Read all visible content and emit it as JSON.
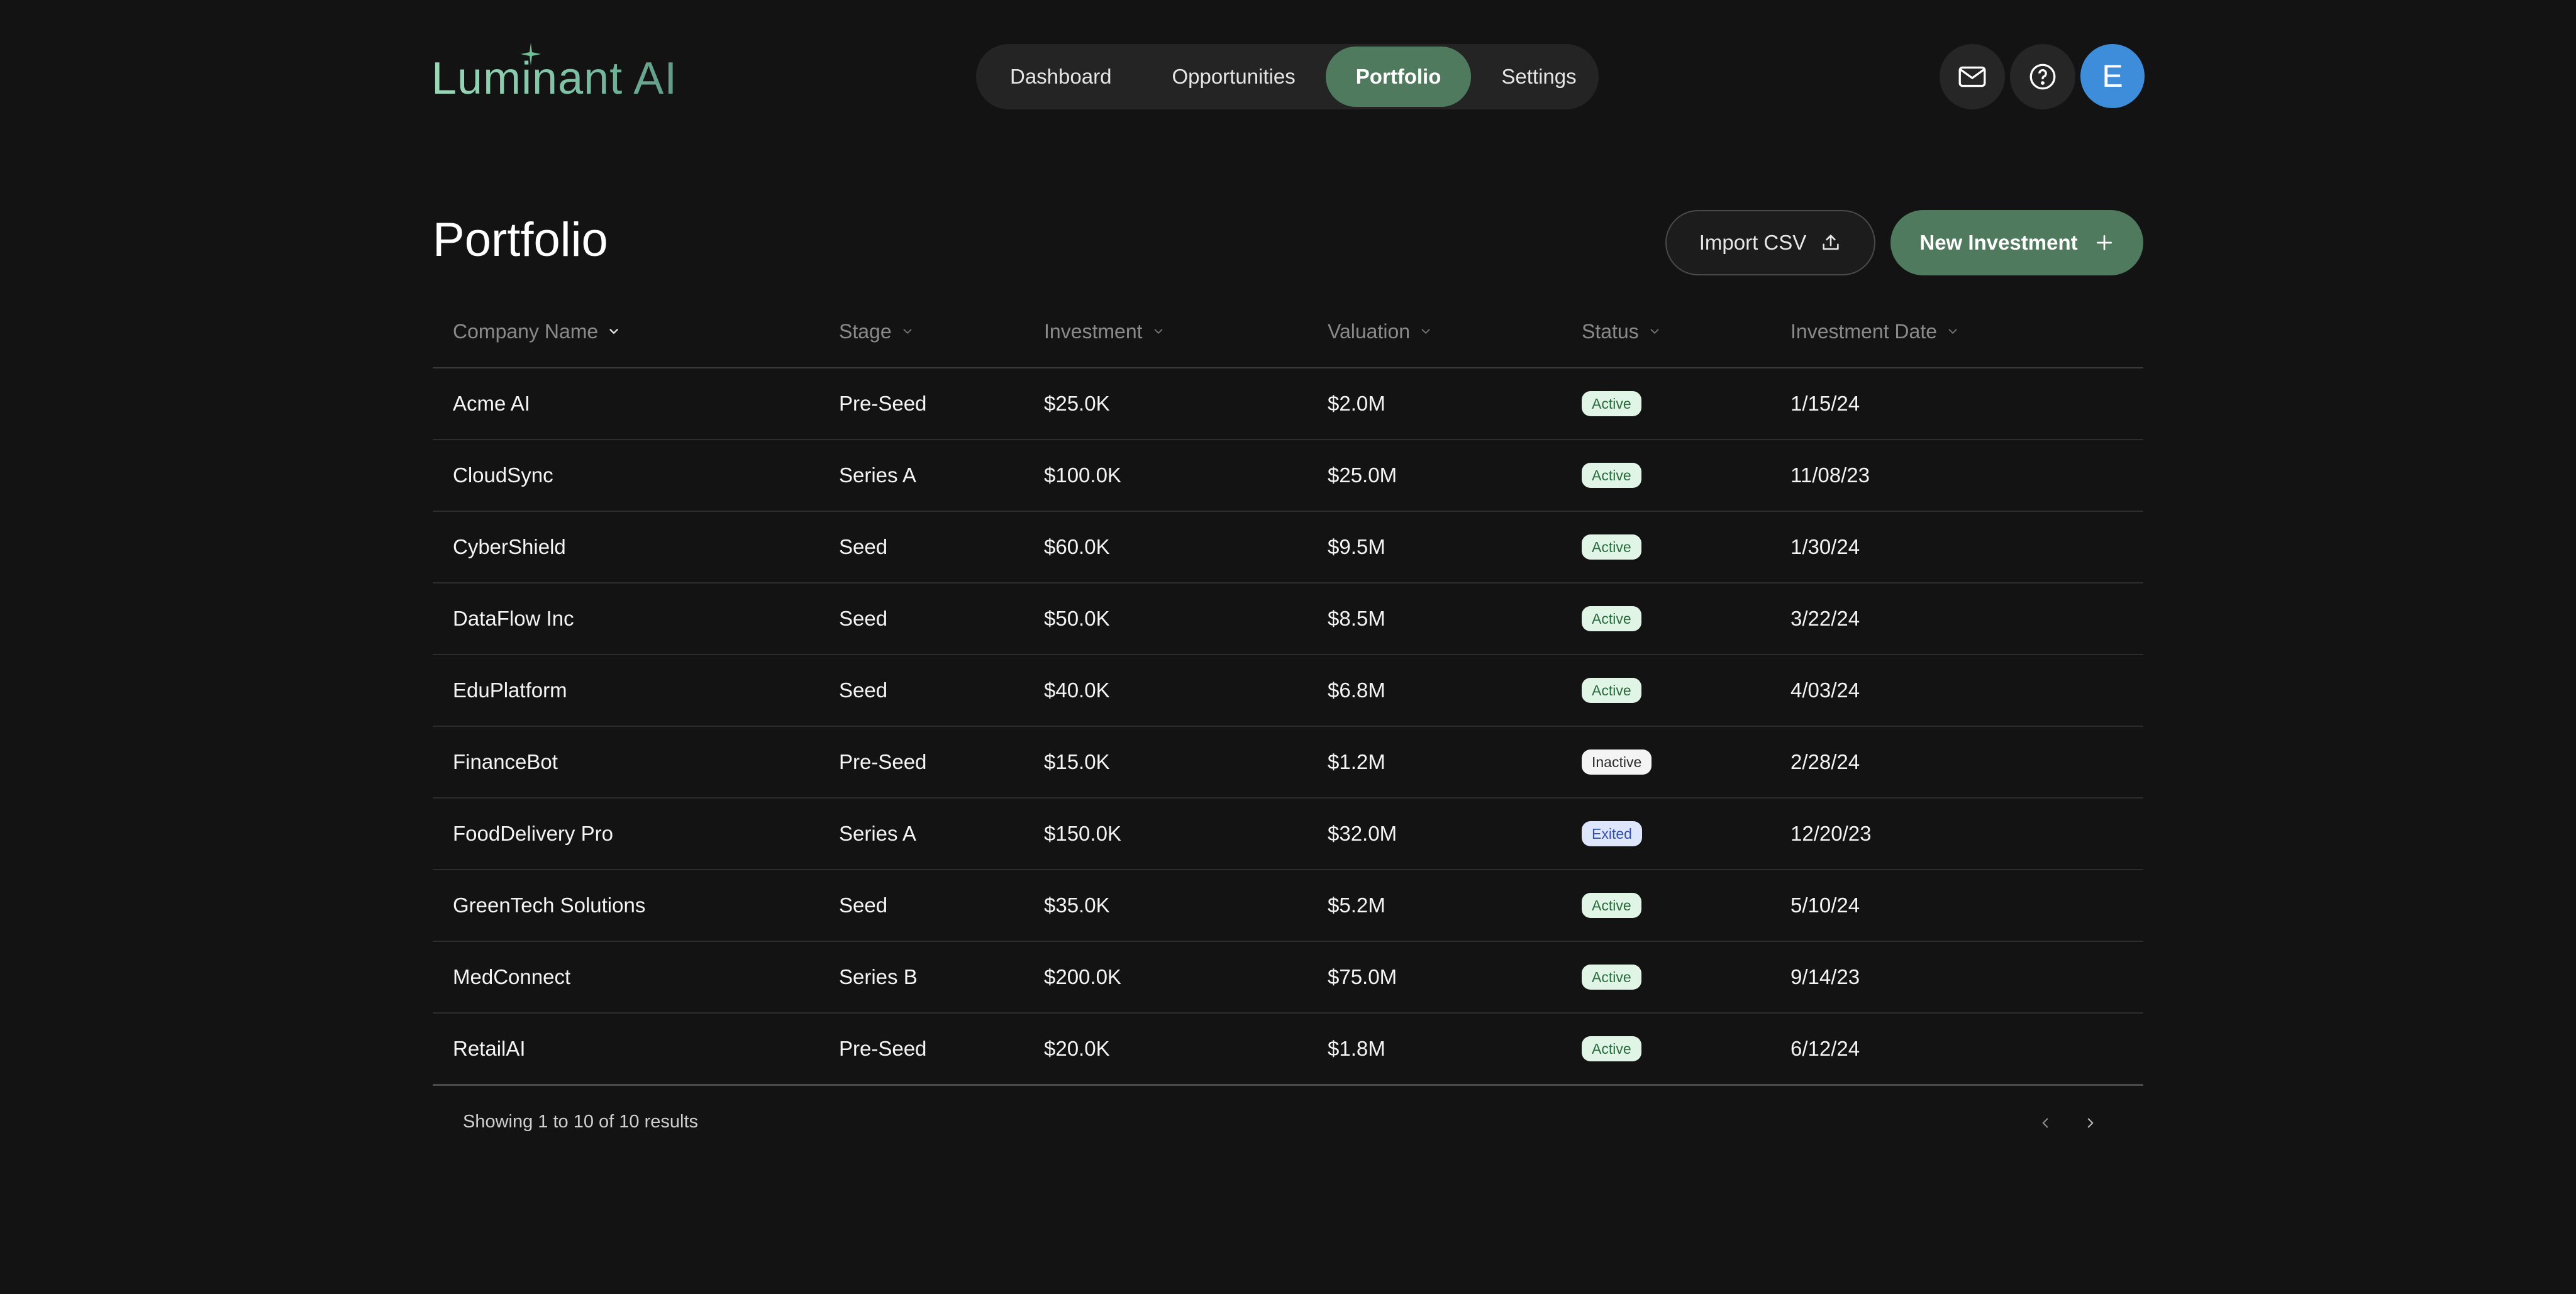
{
  "app": {
    "logo_text": "Luminant AI"
  },
  "nav": {
    "items": [
      {
        "label": "Dashboard",
        "active": false
      },
      {
        "label": "Opportunities",
        "active": false
      },
      {
        "label": "Portfolio",
        "active": true
      },
      {
        "label": "Settings",
        "active": false
      }
    ]
  },
  "header_actions": {
    "mail_icon": "mail-icon",
    "help_icon": "help-icon",
    "avatar_initial": "E",
    "avatar_color": "#3d8ddb"
  },
  "page": {
    "title": "Portfolio",
    "import_label": "Import CSV",
    "new_label": "New Investment"
  },
  "table": {
    "columns": [
      {
        "label": "Company Name",
        "sorted": true
      },
      {
        "label": "Stage",
        "sorted": false
      },
      {
        "label": "Investment",
        "sorted": false
      },
      {
        "label": "Valuation",
        "sorted": false
      },
      {
        "label": "Status",
        "sorted": false
      },
      {
        "label": "Investment Date",
        "sorted": false
      }
    ],
    "rows": [
      {
        "company": "Acme AI",
        "stage": "Pre-Seed",
        "investment": "$25.0K",
        "valuation": "$2.0M",
        "status": "Active",
        "date": "1/15/24"
      },
      {
        "company": "CloudSync",
        "stage": "Series A",
        "investment": "$100.0K",
        "valuation": "$25.0M",
        "status": "Active",
        "date": "11/08/23"
      },
      {
        "company": "CyberShield",
        "stage": "Seed",
        "investment": "$60.0K",
        "valuation": "$9.5M",
        "status": "Active",
        "date": "1/30/24"
      },
      {
        "company": "DataFlow Inc",
        "stage": "Seed",
        "investment": "$50.0K",
        "valuation": "$8.5M",
        "status": "Active",
        "date": "3/22/24"
      },
      {
        "company": "EduPlatform",
        "stage": "Seed",
        "investment": "$40.0K",
        "valuation": "$6.8M",
        "status": "Active",
        "date": "4/03/24"
      },
      {
        "company": "FinanceBot",
        "stage": "Pre-Seed",
        "investment": "$15.0K",
        "valuation": "$1.2M",
        "status": "Inactive",
        "date": "2/28/24"
      },
      {
        "company": "FoodDelivery Pro",
        "stage": "Series A",
        "investment": "$150.0K",
        "valuation": "$32.0M",
        "status": "Exited",
        "date": "12/20/23"
      },
      {
        "company": "GreenTech Solutions",
        "stage": "Seed",
        "investment": "$35.0K",
        "valuation": "$5.2M",
        "status": "Active",
        "date": "5/10/24"
      },
      {
        "company": "MedConnect",
        "stage": "Series B",
        "investment": "$200.0K",
        "valuation": "$75.0M",
        "status": "Active",
        "date": "9/14/23"
      },
      {
        "company": "RetailAI",
        "stage": "Pre-Seed",
        "investment": "$20.0K",
        "valuation": "$1.8M",
        "status": "Active",
        "date": "6/12/24"
      }
    ]
  },
  "footer": {
    "results_text": "Showing 1 to 10 of 10 results"
  },
  "colors": {
    "background": "#131313",
    "accent": "#4f7a5d",
    "status_active": "#e0f5e6",
    "status_inactive": "#f4f4f4",
    "status_exited": "#dde6fb"
  }
}
